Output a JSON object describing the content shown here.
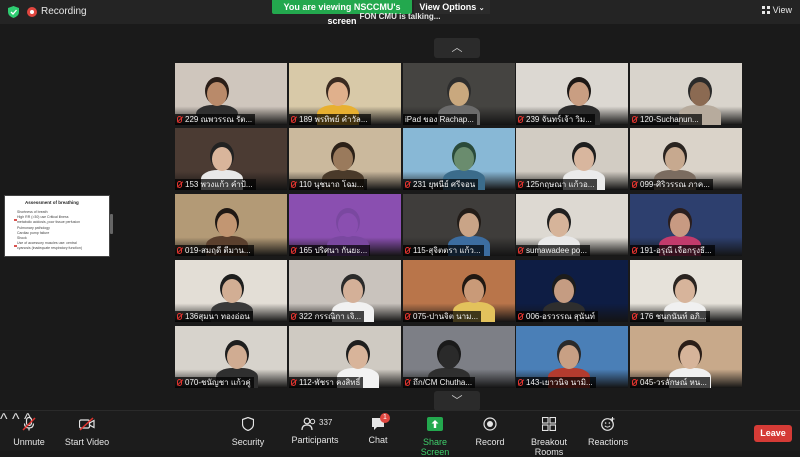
{
  "top": {
    "recording_label": "Recording",
    "banner_text": "You are viewing NSCCMU's screen",
    "view_options_label": "View Options",
    "talking_text": "FON CMU is talking...",
    "view_label": "View",
    "page_up_icon": "chevron-up-icon",
    "page_down_icon": "chevron-down-icon"
  },
  "shared_slide": {
    "title": "Assessment of breathing",
    "lines": [
      "Shortness of breath",
      "High RR (>30) use Critical illness",
      "metabolic acidosis, poor tissue perfusion",
      "Pulmonary pathology",
      "Cardiac pump failure",
      "Shock",
      "Use of accessory muscles use: central",
      "cyanosis (inadequate respiratory function)"
    ]
  },
  "participants": [
    {
      "name": "229 ณพวรรณ รัต...",
      "muted": true,
      "wall": "#cfc6bd",
      "skin": "#b98a6a",
      "shirt": "#2f2f2f",
      "hair": "#2a1e18"
    },
    {
      "name": "189 พรทิพย์ คำวัล...",
      "muted": true,
      "wall": "#d8c9a8",
      "skin": "#e0b08c",
      "shirt": "#e8b030",
      "hair": "#3a2a20"
    },
    {
      "name": "iPad ของ Rachap...",
      "muted": false,
      "wall": "#454441",
      "skin": "#c9a87e",
      "shirt": "#6b6b6b",
      "hair": "#2d2d2d"
    },
    {
      "name": "239 จันทร์เจ้า วิม...",
      "muted": true,
      "wall": "#dcd8d2",
      "skin": "#c99e82",
      "shirt": "#2b2b2b",
      "hair": "#1d1816"
    },
    {
      "name": "120-Suchanun...",
      "muted": true,
      "wall": "#d9d4cc",
      "skin": "#8b6a52",
      "shirt": "#b7ab9d",
      "hair": "#2a2a2a"
    },
    {
      "name": "153 พวงแก้ว คำป้...",
      "muted": true,
      "wall": "#4b3b33",
      "skin": "#d9b59b",
      "shirt": "#e8e8e8",
      "hair": "#222222"
    },
    {
      "name": "110 นุชนาถ โฉม...",
      "muted": true,
      "wall": "#cbb99d",
      "skin": "#9a7a5c",
      "shirt": "#4a3a2a",
      "hair": "#2c2118"
    },
    {
      "name": "231 ยุพนีย์ ศรีจอน",
      "muted": true,
      "wall": "#88b8d6",
      "skin": "#6a8c6e",
      "shirt": "#3b6c8b",
      "hair": "#2a4a3a"
    },
    {
      "name": "125กฤษณา แก้วอ...",
      "muted": true,
      "wall": "#d2ccc3",
      "skin": "#d8b69e",
      "shirt": "#ebebeb",
      "hair": "#1e1e1e"
    },
    {
      "name": "099-ศิริวรรณ ภาค...",
      "muted": true,
      "wall": "#dad3c9",
      "skin": "#c7a98f",
      "shirt": "#7b6c60",
      "hair": "#2a2420"
    },
    {
      "name": "019-สมฤดี ตีมาน...",
      "muted": true,
      "wall": "#b39a76",
      "skin": "#c29672",
      "shirt": "#5a3f2d",
      "hair": "#1f1814"
    },
    {
      "name": "165 ปริศนา กันยะ...",
      "muted": true,
      "wall": "#8a4fb0",
      "skin": "#8a4fb0",
      "shirt": "#7a48a0",
      "hair": "#7a48a0"
    },
    {
      "name": "115-สุจิตตรา แก้ว...",
      "muted": true,
      "wall": "#3f3d3b",
      "skin": "#c9a487",
      "shirt": "#3c6da0",
      "hair": "#221c18"
    },
    {
      "name": "sumawadee po...",
      "muted": true,
      "wall": "#ddd9d2",
      "skin": "#d6b49a",
      "shirt": "#e9e9e9",
      "hair": "#202020"
    },
    {
      "name": "191-อรุณี เจือกรุงธี...",
      "muted": true,
      "wall": "#2d3f6e",
      "skin": "#c89a82",
      "shirt": "#c23b6c",
      "hair": "#2a1e1e"
    },
    {
      "name": "136สุมนา ทองอ่อน",
      "muted": true,
      "wall": "#e3ded6",
      "skin": "#d2ae94",
      "shirt": "#3a3a3a",
      "hair": "#1e1e1e"
    },
    {
      "name": "322 กรรณิกา เจิ...",
      "muted": true,
      "wall": "#c9c3bd",
      "skin": "#d4b098",
      "shirt": "#f1f1f1",
      "hair": "#2a2a2a"
    },
    {
      "name": "075-ปานจิต นาม...",
      "muted": true,
      "wall": "#b9754a",
      "skin": "#c99a78",
      "shirt": "#e3c25c",
      "hair": "#201812"
    },
    {
      "name": "006-อรวรรณ สุนันท์",
      "muted": true,
      "wall": "#0e1d44",
      "skin": "#c59c82",
      "shirt": "#2e2e2e",
      "hair": "#1c1c1c"
    },
    {
      "name": "176 ชนกนันท์ อภิ...",
      "muted": true,
      "wall": "#e6e2da",
      "skin": "#d7b49b",
      "shirt": "#f0f0f0",
      "hair": "#2a2420"
    },
    {
      "name": "070-ชนัญชา แก้วคู่",
      "muted": true,
      "wall": "#d7d3cc",
      "skin": "#d0ac92",
      "shirt": "#2f2f2f",
      "hair": "#1e1e1e"
    },
    {
      "name": "112-พัชรา คงสิทธิ์",
      "muted": true,
      "wall": "#cfcac2",
      "skin": "#d8b49a",
      "shirt": "#f2f2f2",
      "hair": "#1e1e1e"
    },
    {
      "name": "ถึก/CM Chutha...",
      "muted": true,
      "wall": "#7d7f86",
      "skin": "#2a2a2a",
      "shirt": "#2f2f2f",
      "hair": "#1a1a1a"
    },
    {
      "name": "143-เยาวนิจ นามิ...",
      "muted": true,
      "wall": "#4a7fb7",
      "skin": "#c8a084",
      "shirt": "#b33b2e",
      "hair": "#2a2a2a"
    },
    {
      "name": "045-วรลักษณ์ หน...",
      "muted": true,
      "wall": "#c8a98a",
      "skin": "#d6b49a",
      "shirt": "#f0f0f0",
      "hair": "#2a1e18"
    }
  ],
  "toolbar": {
    "unmute": "Unmute",
    "start_video": "Start Video",
    "security": "Security",
    "participants": "Participants",
    "participant_count": "337",
    "chat": "Chat",
    "chat_badge": "1",
    "share_screen": "Share Screen",
    "record": "Record",
    "breakout_rooms": "Breakout Rooms",
    "reactions": "Reactions",
    "leave": "Leave"
  },
  "colors": {
    "share_green": "#23a84e",
    "leave_red": "#d53b36",
    "mute_red": "#e3342f"
  }
}
